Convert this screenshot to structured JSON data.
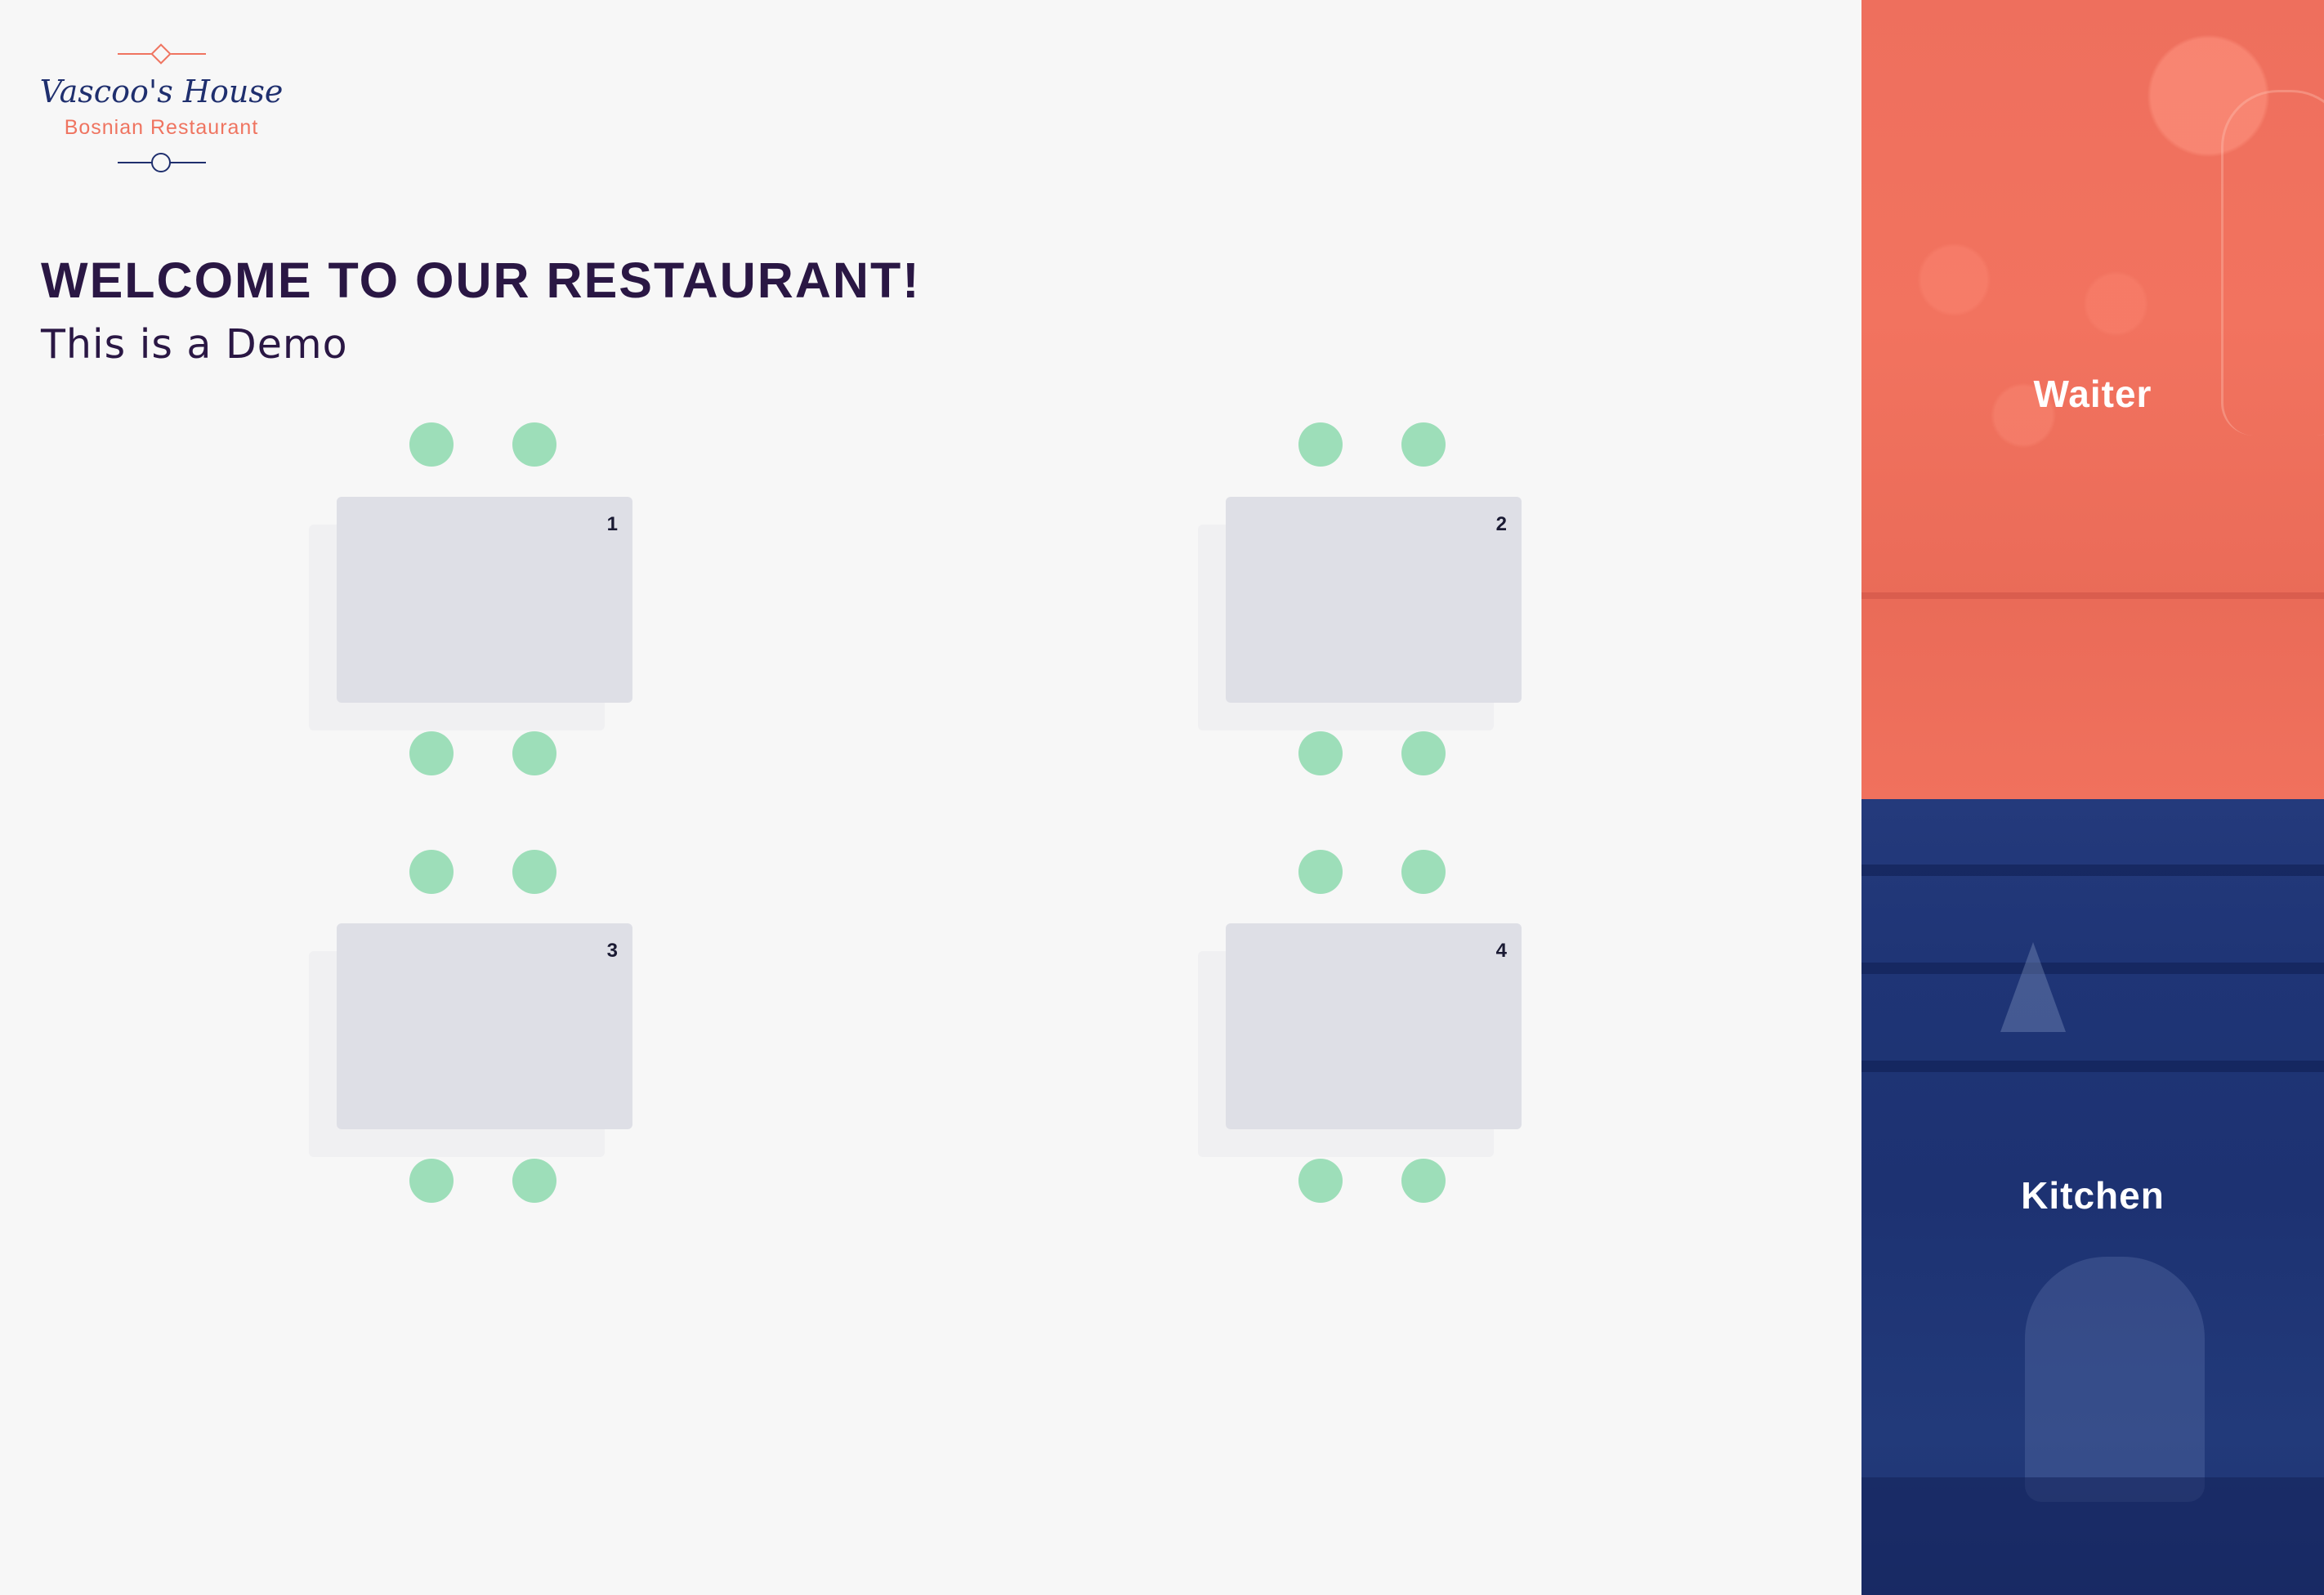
{
  "brand": {
    "name": "Vascoo's House",
    "subtitle": "Bosnian Restaurant",
    "accent_color": "#ef7460",
    "primary_color": "#1f2f6e"
  },
  "header": {
    "welcome": "WELCOME TO OUR RESTAURANT!",
    "subtitle": "This is a Demo"
  },
  "tables": [
    {
      "number": "1",
      "seats": 4
    },
    {
      "number": "2",
      "seats": 4
    },
    {
      "number": "3",
      "seats": 4
    },
    {
      "number": "4",
      "seats": 4
    }
  ],
  "colors": {
    "seat": "#9ddeb9",
    "table": "#dedfe6",
    "waiter_tile": "#f0715d",
    "kitchen_tile": "#1f3576"
  },
  "sidebar": {
    "waiter_label": "Waiter",
    "kitchen_label": "Kitchen"
  }
}
